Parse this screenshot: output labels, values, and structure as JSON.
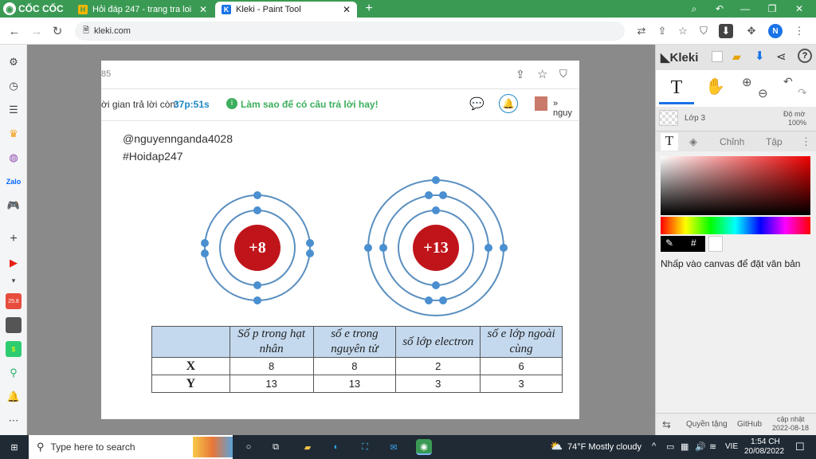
{
  "browser": {
    "brand": "CỐC CỐC",
    "tabs": [
      {
        "title": "Hỏi đáp 247 - trang tra loi",
        "favicon": "H"
      },
      {
        "title": "Kleki - Paint Tool",
        "favicon": "K"
      }
    ],
    "url": "kleki.com",
    "profile_initial": "N"
  },
  "doc": {
    "page_number": "85",
    "timer_label": "ời gian trả lời còn:",
    "timer_value": "37p:51s",
    "tip": "Làm sao để có câu trả lời hay!",
    "user_short": "nguy",
    "mention": "@nguyennganda4028",
    "hashtag": "#Hoidap247",
    "atoms": [
      {
        "label": "+8"
      },
      {
        "label": "+13"
      }
    ],
    "table": {
      "headers": [
        "",
        "Số p trong hạt nhân",
        "số e trong nguyên tử",
        "số lớp electron",
        "số e lớp ngoài cùng"
      ],
      "rows": [
        [
          "X",
          "8",
          "8",
          "2",
          "6"
        ],
        [
          "Y",
          "13",
          "13",
          "3",
          "3"
        ]
      ]
    }
  },
  "kleki": {
    "title": "Kleki",
    "layer_name": "Lớp 3",
    "opacity_label": "Độ mờ",
    "opacity_value": "100%",
    "tabs": [
      "Chỉnh",
      "Tập"
    ],
    "hex_symbol": "#",
    "hint": "Nhấp vào canvas để đặt văn bản",
    "footer": {
      "rights": "Quyền tặng",
      "github": "GitHub",
      "update_label": "cập nhật",
      "update_date": "2022-08-18"
    }
  },
  "taskbar": {
    "search_placeholder": "Type here to search",
    "weather": "74°F  Mostly cloudy",
    "lang": "VIE",
    "time": "1:54 CH",
    "date": "20/08/2022"
  },
  "colors": {
    "tabbar": "#3a9a54",
    "timer": "#1e88c7",
    "tip": "#3cae5c",
    "nucleus": "#c0141b",
    "electron": "#4a8fd0"
  }
}
